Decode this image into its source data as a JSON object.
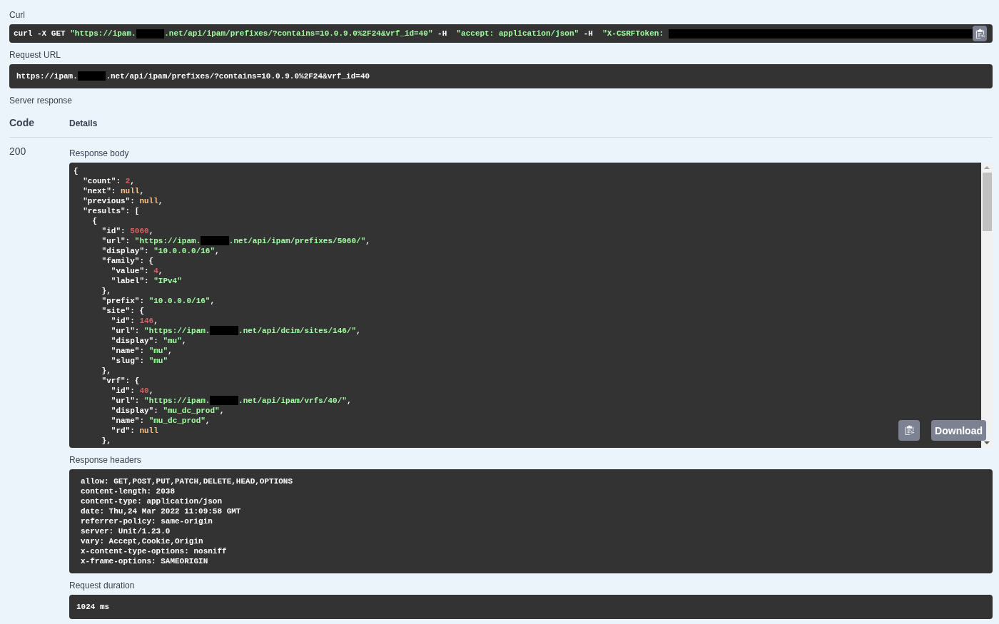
{
  "curl": {
    "label": "Curl",
    "tokens": [
      {
        "kind": "plain",
        "text": "curl -X GET "
      },
      {
        "kind": "string",
        "text": "\"https://ipam."
      },
      {
        "kind": "redacted"
      },
      {
        "kind": "string",
        "text": ".net/api/ipam/prefixes/?contains=10.0.9.0%2F24&vrf_id=40\""
      },
      {
        "kind": "plain",
        "text": " -H  "
      },
      {
        "kind": "string",
        "text": "\"accept: application/json\""
      },
      {
        "kind": "plain",
        "text": " -H  "
      },
      {
        "kind": "string",
        "text": "\"X-CSRFToken: "
      },
      {
        "kind": "redacted"
      }
    ]
  },
  "request_url": {
    "label": "Request URL",
    "tokens": [
      {
        "kind": "plain",
        "text": "https://ipam."
      },
      {
        "kind": "redacted"
      },
      {
        "kind": "plain",
        "text": ".net/api/ipam/prefixes/?contains=10.0.9.0%2F24&vrf_id=40"
      }
    ]
  },
  "server_response": {
    "label": "Server response",
    "columns": [
      "Code",
      "Details"
    ],
    "code": "200",
    "response_body": {
      "label": "Response body",
      "lines": [
        [
          {
            "kind": "plain",
            "text": "{"
          }
        ],
        [
          {
            "kind": "plain",
            "text": "  \"count\": "
          },
          {
            "kind": "number",
            "text": "2"
          },
          {
            "kind": "plain",
            "text": ","
          }
        ],
        [
          {
            "kind": "plain",
            "text": "  \"next\": "
          },
          {
            "kind": "literal",
            "text": "null"
          },
          {
            "kind": "plain",
            "text": ","
          }
        ],
        [
          {
            "kind": "plain",
            "text": "  \"previous\": "
          },
          {
            "kind": "literal",
            "text": "null"
          },
          {
            "kind": "plain",
            "text": ","
          }
        ],
        [
          {
            "kind": "plain",
            "text": "  \"results\": ["
          }
        ],
        [
          {
            "kind": "plain",
            "text": "    {"
          }
        ],
        [
          {
            "kind": "plain",
            "text": "      \"id\": "
          },
          {
            "kind": "number",
            "text": "5060"
          },
          {
            "kind": "plain",
            "text": ","
          }
        ],
        [
          {
            "kind": "plain",
            "text": "      \"url\": "
          },
          {
            "kind": "string",
            "text": "\"https://ipam."
          },
          {
            "kind": "redacted"
          },
          {
            "kind": "string",
            "text": ".net/api/ipam/prefixes/5060/\""
          },
          {
            "kind": "plain",
            "text": ","
          }
        ],
        [
          {
            "kind": "plain",
            "text": "      \"display\": "
          },
          {
            "kind": "string",
            "text": "\"10.0.0.0/16\""
          },
          {
            "kind": "plain",
            "text": ","
          }
        ],
        [
          {
            "kind": "plain",
            "text": "      \"family\": {"
          }
        ],
        [
          {
            "kind": "plain",
            "text": "        \"value\": "
          },
          {
            "kind": "number",
            "text": "4"
          },
          {
            "kind": "plain",
            "text": ","
          }
        ],
        [
          {
            "kind": "plain",
            "text": "        \"label\": "
          },
          {
            "kind": "string",
            "text": "\"IPv4\""
          }
        ],
        [
          {
            "kind": "plain",
            "text": "      },"
          }
        ],
        [
          {
            "kind": "plain",
            "text": "      \"prefix\": "
          },
          {
            "kind": "string",
            "text": "\"10.0.0.0/16\""
          },
          {
            "kind": "plain",
            "text": ","
          }
        ],
        [
          {
            "kind": "plain",
            "text": "      \"site\": {"
          }
        ],
        [
          {
            "kind": "plain",
            "text": "        \"id\": "
          },
          {
            "kind": "number",
            "text": "146"
          },
          {
            "kind": "plain",
            "text": ","
          }
        ],
        [
          {
            "kind": "plain",
            "text": "        \"url\": "
          },
          {
            "kind": "string",
            "text": "\"https://ipam."
          },
          {
            "kind": "redacted"
          },
          {
            "kind": "string",
            "text": ".net/api/dcim/sites/146/\""
          },
          {
            "kind": "plain",
            "text": ","
          }
        ],
        [
          {
            "kind": "plain",
            "text": "        \"display\": "
          },
          {
            "kind": "string",
            "text": "\"mu\""
          },
          {
            "kind": "plain",
            "text": ","
          }
        ],
        [
          {
            "kind": "plain",
            "text": "        \"name\": "
          },
          {
            "kind": "string",
            "text": "\"mu\""
          },
          {
            "kind": "plain",
            "text": ","
          }
        ],
        [
          {
            "kind": "plain",
            "text": "        \"slug\": "
          },
          {
            "kind": "string",
            "text": "\"mu\""
          }
        ],
        [
          {
            "kind": "plain",
            "text": "      },"
          }
        ],
        [
          {
            "kind": "plain",
            "text": "      \"vrf\": {"
          }
        ],
        [
          {
            "kind": "plain",
            "text": "        \"id\": "
          },
          {
            "kind": "number",
            "text": "40"
          },
          {
            "kind": "plain",
            "text": ","
          }
        ],
        [
          {
            "kind": "plain",
            "text": "        \"url\": "
          },
          {
            "kind": "string",
            "text": "\"https://ipam."
          },
          {
            "kind": "redacted"
          },
          {
            "kind": "string",
            "text": ".net/api/ipam/vrfs/40/\""
          },
          {
            "kind": "plain",
            "text": ","
          }
        ],
        [
          {
            "kind": "plain",
            "text": "        \"display\": "
          },
          {
            "kind": "string",
            "text": "\"mu_dc_prod\""
          },
          {
            "kind": "plain",
            "text": ","
          }
        ],
        [
          {
            "kind": "plain",
            "text": "        \"name\": "
          },
          {
            "kind": "string",
            "text": "\"mu_dc_prod\""
          },
          {
            "kind": "plain",
            "text": ","
          }
        ],
        [
          {
            "kind": "plain",
            "text": "        \"rd\": "
          },
          {
            "kind": "literal",
            "text": "null"
          }
        ],
        [
          {
            "kind": "plain",
            "text": "      },"
          }
        ]
      ],
      "buttons": [
        {
          "kind": "copy"
        },
        {
          "kind": "download",
          "label": "Download"
        }
      ]
    },
    "response_headers": {
      "label": "Response headers",
      "lines": [
        "allow: GET,POST,PUT,PATCH,DELETE,HEAD,OPTIONS",
        "content-length: 2038",
        "content-type: application/json",
        "date: Thu,24 Mar 2022 11:09:58 GMT",
        "referrer-policy: same-origin",
        "server: Unit/1.23.0",
        "vary: Accept,Cookie,Origin",
        "x-content-type-options: nosniff",
        "x-frame-options: SAMEORIGIN"
      ]
    },
    "request_duration": {
      "label": "Request duration",
      "value": "1024 ms"
    }
  }
}
